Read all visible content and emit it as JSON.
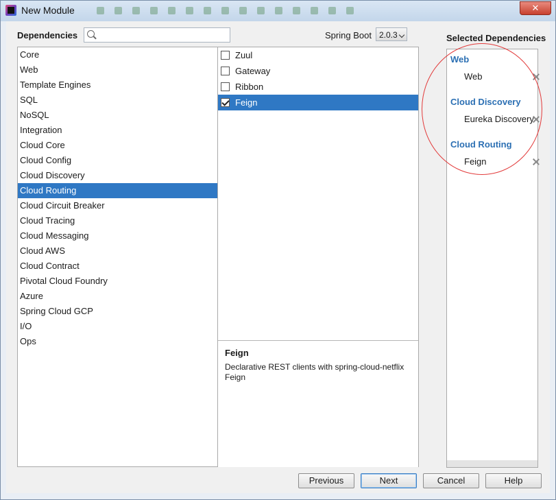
{
  "window": {
    "title": "New Module",
    "close_label": "✕"
  },
  "header": {
    "dependencies_label": "Dependencies",
    "search": {
      "value": "",
      "placeholder": ""
    },
    "spring_boot_label": "Spring Boot",
    "spring_boot_version": "2.0.3"
  },
  "categories": [
    "Core",
    "Web",
    "Template Engines",
    "SQL",
    "NoSQL",
    "Integration",
    "Cloud Core",
    "Cloud Config",
    "Cloud Discovery",
    "Cloud Routing",
    "Cloud Circuit Breaker",
    "Cloud Tracing",
    "Cloud Messaging",
    "Cloud AWS",
    "Cloud Contract",
    "Pivotal Cloud Foundry",
    "Azure",
    "Spring Cloud GCP",
    "I/O",
    "Ops"
  ],
  "selected_category": "Cloud Routing",
  "options": [
    {
      "label": "Zuul",
      "checked": false
    },
    {
      "label": "Gateway",
      "checked": false
    },
    {
      "label": "Ribbon",
      "checked": false
    },
    {
      "label": "Feign",
      "checked": true
    }
  ],
  "description": {
    "title": "Feign",
    "text": "Declarative REST clients with spring-cloud-netflix Feign"
  },
  "selected_dependencies": {
    "title": "Selected Dependencies",
    "groups": [
      {
        "name": "Web",
        "items": [
          "Web"
        ]
      },
      {
        "name": "Cloud Discovery",
        "items": [
          "Eureka Discovery"
        ]
      },
      {
        "name": "Cloud Routing",
        "items": [
          "Feign"
        ]
      }
    ]
  },
  "buttons": {
    "previous": "Previous",
    "next": "Next",
    "cancel": "Cancel",
    "help": "Help"
  },
  "colors": {
    "selection": "#2f78c4",
    "group_header": "#2b6fb3",
    "annotation_circle": "#e23a3a"
  }
}
